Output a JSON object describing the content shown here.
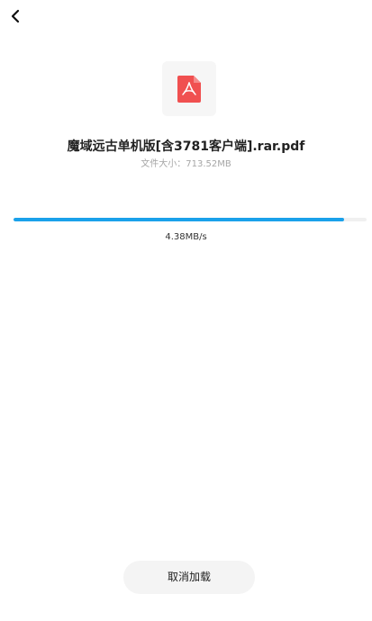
{
  "nav": {
    "back_icon": "chevron-left-icon"
  },
  "file": {
    "icon": "pdf-file-icon",
    "icon_color": "#f05050",
    "name": "魔域远古单机版[含3781客户端].rar.pdf",
    "size_text": "文件大小：713.52MB"
  },
  "download": {
    "progress_fraction": 0.935,
    "progress_color": "#1aa1ea",
    "speed_text": "4.38MB/s"
  },
  "actions": {
    "cancel_label": "取消加载"
  }
}
